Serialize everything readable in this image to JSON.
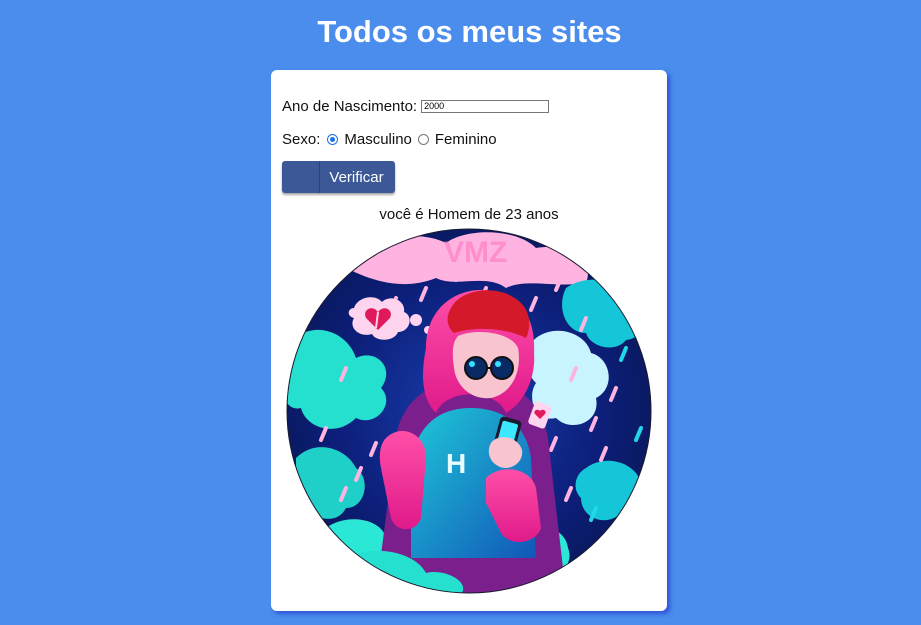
{
  "header": {
    "title": "Todos os meus sites"
  },
  "form": {
    "birth_label": "Ano de Nascimento:",
    "birth_value": "2000",
    "sex_label": "Sexo:",
    "sex_options": [
      {
        "label": "Masculino",
        "checked": true
      },
      {
        "label": "Feminino",
        "checked": false
      }
    ],
    "verify_label": "Verificar"
  },
  "result": {
    "text": "você é Homem de 23 anos",
    "image": {
      "description_icon": "avatar-illustration",
      "watermark": "VMZ"
    }
  },
  "colors": {
    "background": "#4a8ded",
    "card": "#ffffff",
    "button": "#3d5897",
    "radio_accent": "#1a73e8"
  }
}
